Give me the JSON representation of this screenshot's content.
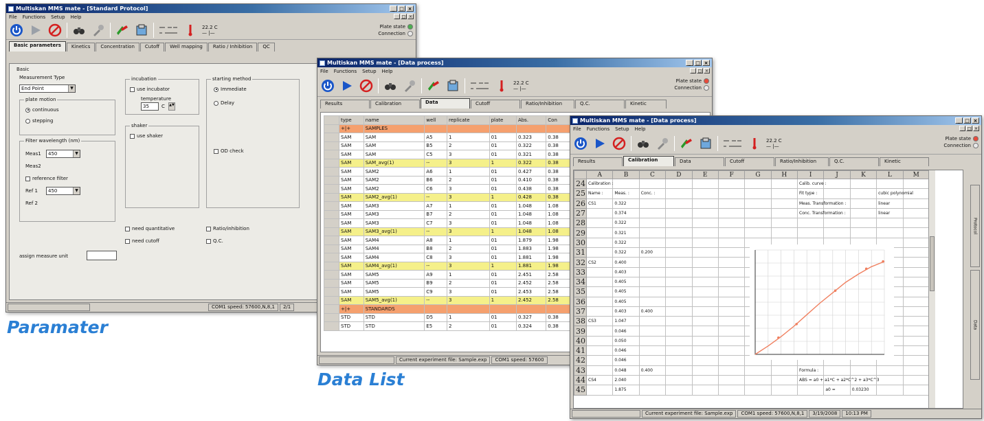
{
  "colors": {
    "accent": "#2a7fd4",
    "title_bar": "#0a246a",
    "samples_group": "#f5a06e",
    "avg_row": "#f5f08a",
    "curve": "#f08060"
  },
  "icons": [
    "power-icon",
    "play-icon",
    "stop-icon",
    "binoculars-icon",
    "wrench-icon",
    "plate-icon",
    "reader-icon",
    "temperature-icon"
  ],
  "captions": {
    "param": "Paramater",
    "data_list": "Data List"
  },
  "win1": {
    "title": "Multiskan MMS mate - [Standard Protocol]",
    "menu": [
      "File",
      "Functions",
      "Setup",
      "Help"
    ],
    "temp": "22.2 C",
    "plate_state": "Plate state",
    "connection": "Connection",
    "tabs": [
      "Basic parameters",
      "Kinetics",
      "Concentration",
      "Cutoff",
      "Well mapping",
      "Ratio / Inhibition",
      "QC"
    ],
    "basic_label": "Basic",
    "meas_type_label": "Measurement Type",
    "meas_type_value": "End Point",
    "plate_motion_label": "plate motion",
    "continuous": "continuous",
    "stepping": "stepping",
    "filter_label": "Filter wavelength (nm)",
    "meas1": "Meas1",
    "meas1_value": "450",
    "meas2": "Meas2",
    "ref_filter": "reference filter",
    "ref1": "Ref 1",
    "ref1_value": "450",
    "ref2": "Ref 2",
    "incubation_label": "incubation",
    "use_incubator": "use incubator",
    "temperature_label": "temperature",
    "temp_value": "35",
    "temp_unit": "C",
    "shaker_label": "shaker",
    "use_shaker": "use shaker",
    "starting_label": "starting method",
    "immediate": "Immediate",
    "delay": "Delay",
    "od_check": "OD check",
    "need_quant": "need quantitative",
    "need_cutoff": "need cutoff",
    "ratio_inhib": "Ratio/inhibition",
    "qc": "Q.C.",
    "assign_label": "assign measure unit",
    "status": "COM1 speed: 57600,N,8,1",
    "status_tail": "2/1"
  },
  "win2": {
    "title": "Multiskan MMS mate - [Data process]",
    "menu": [
      "File",
      "Functions",
      "Setup",
      "Help"
    ],
    "temp": "22.2 C",
    "plate_state": "Plate state",
    "connection": "Connection",
    "tabs": [
      "Results",
      "Calibration",
      "Data",
      "Cutoff",
      "Ratio/Inhibition",
      "Q.C.",
      "Kinetic"
    ],
    "columns": [
      "type",
      "name",
      "well",
      "replicate",
      "plate",
      "Abs.",
      "Con"
    ],
    "rows": [
      {
        "kind": "group",
        "cells": [
          "+|+",
          "SAMPLES",
          "",
          "",
          "",
          "",
          ""
        ]
      },
      {
        "kind": "row",
        "cells": [
          "SAM",
          "SAM",
          "A5",
          "1",
          "01",
          "0.323",
          "0.38"
        ]
      },
      {
        "kind": "row",
        "cells": [
          "SAM",
          "SAM",
          "B5",
          "2",
          "01",
          "0.322",
          "0.38"
        ]
      },
      {
        "kind": "row",
        "cells": [
          "SAM",
          "SAM",
          "C5",
          "3",
          "01",
          "0.321",
          "0.38"
        ]
      },
      {
        "kind": "avg",
        "cells": [
          "SAM",
          "SAM_avg(1)",
          "--",
          "3",
          "1",
          "0.322",
          "0.38"
        ]
      },
      {
        "kind": "row",
        "cells": [
          "SAM",
          "SAM2",
          "A6",
          "1",
          "01",
          "0.427",
          "0.38"
        ]
      },
      {
        "kind": "row",
        "cells": [
          "SAM",
          "SAM2",
          "B6",
          "2",
          "01",
          "0.410",
          "0.38"
        ]
      },
      {
        "kind": "row",
        "cells": [
          "SAM",
          "SAM2",
          "C6",
          "3",
          "01",
          "0.438",
          "0.38"
        ]
      },
      {
        "kind": "avg",
        "cells": [
          "SAM",
          "SAM2_avg(1)",
          "--",
          "3",
          "1",
          "0.428",
          "0.38"
        ]
      },
      {
        "kind": "row",
        "cells": [
          "SAM",
          "SAM3",
          "A7",
          "1",
          "01",
          "1.048",
          "1.08"
        ]
      },
      {
        "kind": "row",
        "cells": [
          "SAM",
          "SAM3",
          "B7",
          "2",
          "01",
          "1.048",
          "1.08"
        ]
      },
      {
        "kind": "row",
        "cells": [
          "SAM",
          "SAM3",
          "C7",
          "3",
          "01",
          "1.048",
          "1.08"
        ]
      },
      {
        "kind": "avg",
        "cells": [
          "SAM",
          "SAM3_avg(1)",
          "--",
          "3",
          "1",
          "1.048",
          "1.08"
        ]
      },
      {
        "kind": "row",
        "cells": [
          "SAM",
          "SAM4",
          "A8",
          "1",
          "01",
          "1.879",
          "1.98"
        ]
      },
      {
        "kind": "row",
        "cells": [
          "SAM",
          "SAM4",
          "B8",
          "2",
          "01",
          "1.883",
          "1.98"
        ]
      },
      {
        "kind": "row",
        "cells": [
          "SAM",
          "SAM4",
          "C8",
          "3",
          "01",
          "1.881",
          "1.98"
        ]
      },
      {
        "kind": "avg",
        "cells": [
          "SAM",
          "SAM4_avg(1)",
          "--",
          "3",
          "1",
          "1.881",
          "1.98"
        ]
      },
      {
        "kind": "row",
        "cells": [
          "SAM",
          "SAM5",
          "A9",
          "1",
          "01",
          "2.451",
          "2.58"
        ]
      },
      {
        "kind": "row",
        "cells": [
          "SAM",
          "SAM5",
          "B9",
          "2",
          "01",
          "2.452",
          "2.58"
        ]
      },
      {
        "kind": "row",
        "cells": [
          "SAM",
          "SAM5",
          "C9",
          "3",
          "01",
          "2.453",
          "2.58"
        ]
      },
      {
        "kind": "avg",
        "cells": [
          "SAM",
          "SAM5_avg(1)",
          "--",
          "3",
          "1",
          "2.452",
          "2.58"
        ]
      },
      {
        "kind": "group",
        "cells": [
          "+|+",
          "STANDARDS",
          "",
          "",
          "",
          "",
          ""
        ]
      },
      {
        "kind": "row",
        "cells": [
          "STD",
          "STD",
          "D5",
          "1",
          "01",
          "0.327",
          "0.38"
        ]
      },
      {
        "kind": "row",
        "cells": [
          "STD",
          "STD",
          "E5",
          "2",
          "01",
          "0.324",
          "0.38"
        ]
      }
    ],
    "status_file": "Current experiment file: Sample.exp",
    "status_com": "COM1 speed: 57600"
  },
  "win3": {
    "title": "Multiskan MMS mate - [Data process]",
    "menu": [
      "File",
      "Functions",
      "Setup",
      "Help"
    ],
    "temp": "22.2 C",
    "plate_state": "Plate state",
    "connection": "Connection",
    "tabs": [
      "Results",
      "Calibration",
      "Data",
      "Cutoff",
      "Ratio/Inhibition",
      "Q.C.",
      "Kinetic"
    ],
    "col_letters": [
      "A",
      "B",
      "C",
      "D",
      "E",
      "F",
      "G",
      "H",
      "I",
      "J",
      "K",
      "L",
      "M"
    ],
    "row_numbers": [
      "24",
      "25",
      "26",
      "27",
      "28",
      "29",
      "30",
      "31",
      "32",
      "33",
      "34",
      "35",
      "36",
      "37",
      "38",
      "39",
      "40",
      "41",
      "42",
      "43",
      "44",
      "45"
    ],
    "left_rows": [
      [
        "Calibration :",
        "",
        ""
      ],
      [
        "Name :",
        "Meas. :",
        "Conc. :"
      ],
      [
        "CS1",
        "0.322",
        ""
      ],
      [
        "",
        "0.374",
        ""
      ],
      [
        "",
        "0.322",
        ""
      ],
      [
        "",
        "0.321",
        ""
      ],
      [
        "",
        "0.322",
        ""
      ],
      [
        "",
        "0.322",
        "0.200"
      ],
      [
        "CS2",
        "0.400",
        ""
      ],
      [
        "",
        "0.403",
        ""
      ],
      [
        "",
        "0.405",
        ""
      ],
      [
        "",
        "0.405",
        ""
      ],
      [
        "",
        "0.405",
        ""
      ],
      [
        "",
        "0.403",
        "0.400"
      ],
      [
        "CS3",
        "1.047",
        ""
      ],
      [
        "",
        "0.046",
        ""
      ],
      [
        "",
        "0.050",
        ""
      ],
      [
        "",
        "0.046",
        ""
      ],
      [
        "",
        "0.046",
        ""
      ],
      [
        "",
        "0.048",
        "0.400"
      ],
      [
        "CS4",
        "2.040",
        ""
      ],
      [
        "",
        "1.875",
        ""
      ]
    ],
    "curve_params": [
      "Calib. curve :",
      "Fit type :",
      "Meas. Transformation :",
      "Conc. Transformation :"
    ],
    "curve_values": [
      "",
      "cubic polynomial",
      "linear",
      "linear"
    ],
    "formula_label": "Formula :",
    "formula": "ABS = a0 + a1*C + a2*C^2 + a3*C^3",
    "a0_label": "a0 =",
    "a0_value": "0.03230",
    "side_tabs": [
      "Protocol",
      "Data"
    ],
    "status_file": "Current experiment file: Sample.exp",
    "status_com": "COM1 speed: 57600,N,8,1",
    "status_date": "3/19/2008",
    "status_time": "10:13 PM"
  },
  "chart_data": {
    "type": "line",
    "x": [
      0,
      0.1,
      0.2,
      0.3,
      0.4,
      0.5,
      0.6,
      0.7,
      0.8,
      0.9,
      1.0
    ],
    "series": [
      {
        "values": [
          0,
          0.08,
          0.17,
          0.27,
          0.38,
          0.49,
          0.59,
          0.69,
          0.77,
          0.84,
          0.89
        ]
      }
    ],
    "points": [
      [
        0.18,
        0.16
      ],
      [
        0.32,
        0.29
      ],
      [
        0.62,
        0.61
      ],
      [
        0.86,
        0.82
      ],
      [
        0.99,
        0.89
      ]
    ],
    "grid": true
  }
}
